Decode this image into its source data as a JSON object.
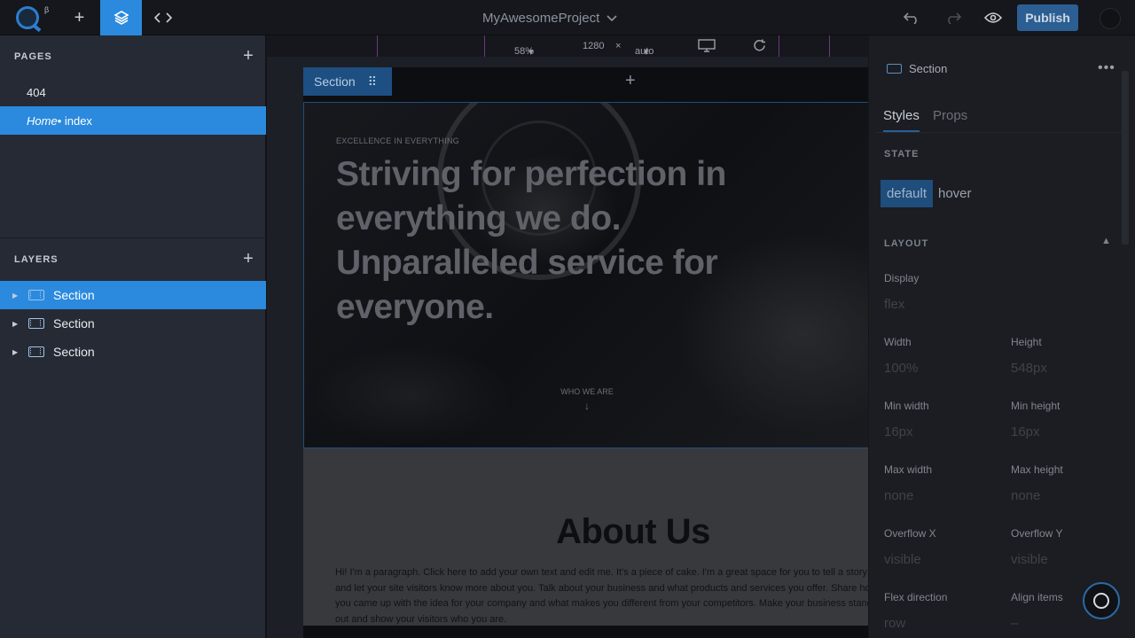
{
  "topbar": {
    "logo_beta": "β",
    "project_name": "MyAwesomeProject",
    "publish_label": "Publish"
  },
  "canvas_toolbar": {
    "zoom": "58%",
    "width": "1280",
    "times": "×",
    "height": "auto"
  },
  "left_panel": {
    "pages_title": "PAGES",
    "pages": [
      {
        "name": "404",
        "suffix": ""
      },
      {
        "name": "Home",
        "suffix": " • index"
      }
    ],
    "layers_title": "LAYERS",
    "layers": [
      {
        "label": "Section",
        "selected": true
      },
      {
        "label": "Section",
        "selected": false
      },
      {
        "label": "Section",
        "selected": false
      }
    ]
  },
  "canvas": {
    "section_tag": "Section",
    "hero_kicker": "EXCELLENCE IN EVERYTHING",
    "hero_title": "Striving for perfection in everything we do. Unparalleled service for everyone.",
    "hero_who": "WHO WE ARE",
    "about_title": "About Us",
    "about_text": "Hi! I'm a paragraph. Click here to add your own text and edit me. It's a piece of cake. I'm a great space for you to tell a story and let your site visitors know more about you. Talk about your business and what products and services you offer. Share how you came up with the idea for your company and what makes you different from your competitors. Make your business stand out and show your visitors who you are."
  },
  "right_panel": {
    "element_name": "Section",
    "more": "•••",
    "tabs": [
      "Styles",
      "Props"
    ],
    "state_title": "STATE",
    "state_default": "default",
    "state_hover": "hover",
    "layout_title": "LAYOUT",
    "display_label": "Display",
    "display_value": "flex",
    "width_label": "Width",
    "width_value": "100%",
    "height_label": "Height",
    "height_value": "548px",
    "min_width_label": "Min width",
    "min_width_value": "16px",
    "min_height_label": "Min height",
    "min_height_value": "16px",
    "max_width_label": "Max width",
    "max_width_value": "none",
    "max_height_label": "Max height",
    "max_height_value": "none",
    "overflow_x_label": "Overflow X",
    "overflow_x_value": "visible",
    "overflow_y_label": "Overflow Y",
    "overflow_y_value": "visible",
    "flex_direction_label": "Flex direction",
    "flex_direction_value": "row",
    "align_items_label": "Align items",
    "align_items_value": "–"
  },
  "colors": {
    "accent": "#2b8ade",
    "publish": "#2b5f93",
    "panel_bg": "#262a34"
  }
}
